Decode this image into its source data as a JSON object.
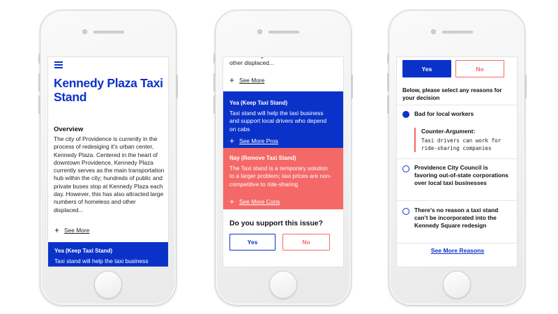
{
  "colors": {
    "primary_blue": "#0a32c8",
    "coral": "#f46968",
    "phone_body": "#f2f2f3"
  },
  "screen1": {
    "menu_icon": "hamburger-icon",
    "title": "Kennedy Plaza Taxi Stand",
    "overview_heading": "Overview",
    "overview_text": "The city of Providence is currently in the process of redesiging it's urban center, Kennedy Plaza. Centered in the heart of downtown Providence, Kennedy Plaza currently serves as the main transportation hub within the city; hundreds of public and private buses stop at Kennedy Plaza each day. However, this has also attracted large numbers of homeless and other displaced...",
    "see_more": "See More",
    "yea_title": "Yea (Keep Taxi Stand)",
    "yea_text": "Taxi stand will help the taxi business and support local drivers"
  },
  "screen2": {
    "top_text": "attracted large numbers of homeless and other displaced...",
    "see_more": "See More",
    "yea_title": "Yea (Keep Taxi Stand)",
    "yea_text": "Taxi stand will help the taxi business and support local drivers who depend on cabs",
    "see_more_pros": "See More Pros",
    "nay_title": "Nay (Remove Taxi Stand)",
    "nay_text": "The Taxi stand is a temporary solution to a larger problem; taxi prices are non-competitive to ride-sharing",
    "see_more_cons": "See More Cons",
    "question": "Do you support this issue?",
    "yes_label": "Yes",
    "no_label": "No"
  },
  "screen3": {
    "yes_label": "Yes",
    "no_label": "No",
    "yes_selected": true,
    "prompt": "Below, please select any reasons for your decision",
    "reasons": [
      {
        "label": "Bad for local workers",
        "checked": true
      },
      {
        "label": "Providence City Council is favoring out-of-state corporations over local taxi businesses",
        "checked": false
      },
      {
        "label": "There’s no reason a taxi stand can’t be incorporated into the Kennedy Square redesign",
        "checked": false
      }
    ],
    "counter_heading": "Counter-Argument:",
    "counter_text": "Taxi drivers can work for ride-sharing companies",
    "see_more_reasons": "See More Reasons"
  }
}
